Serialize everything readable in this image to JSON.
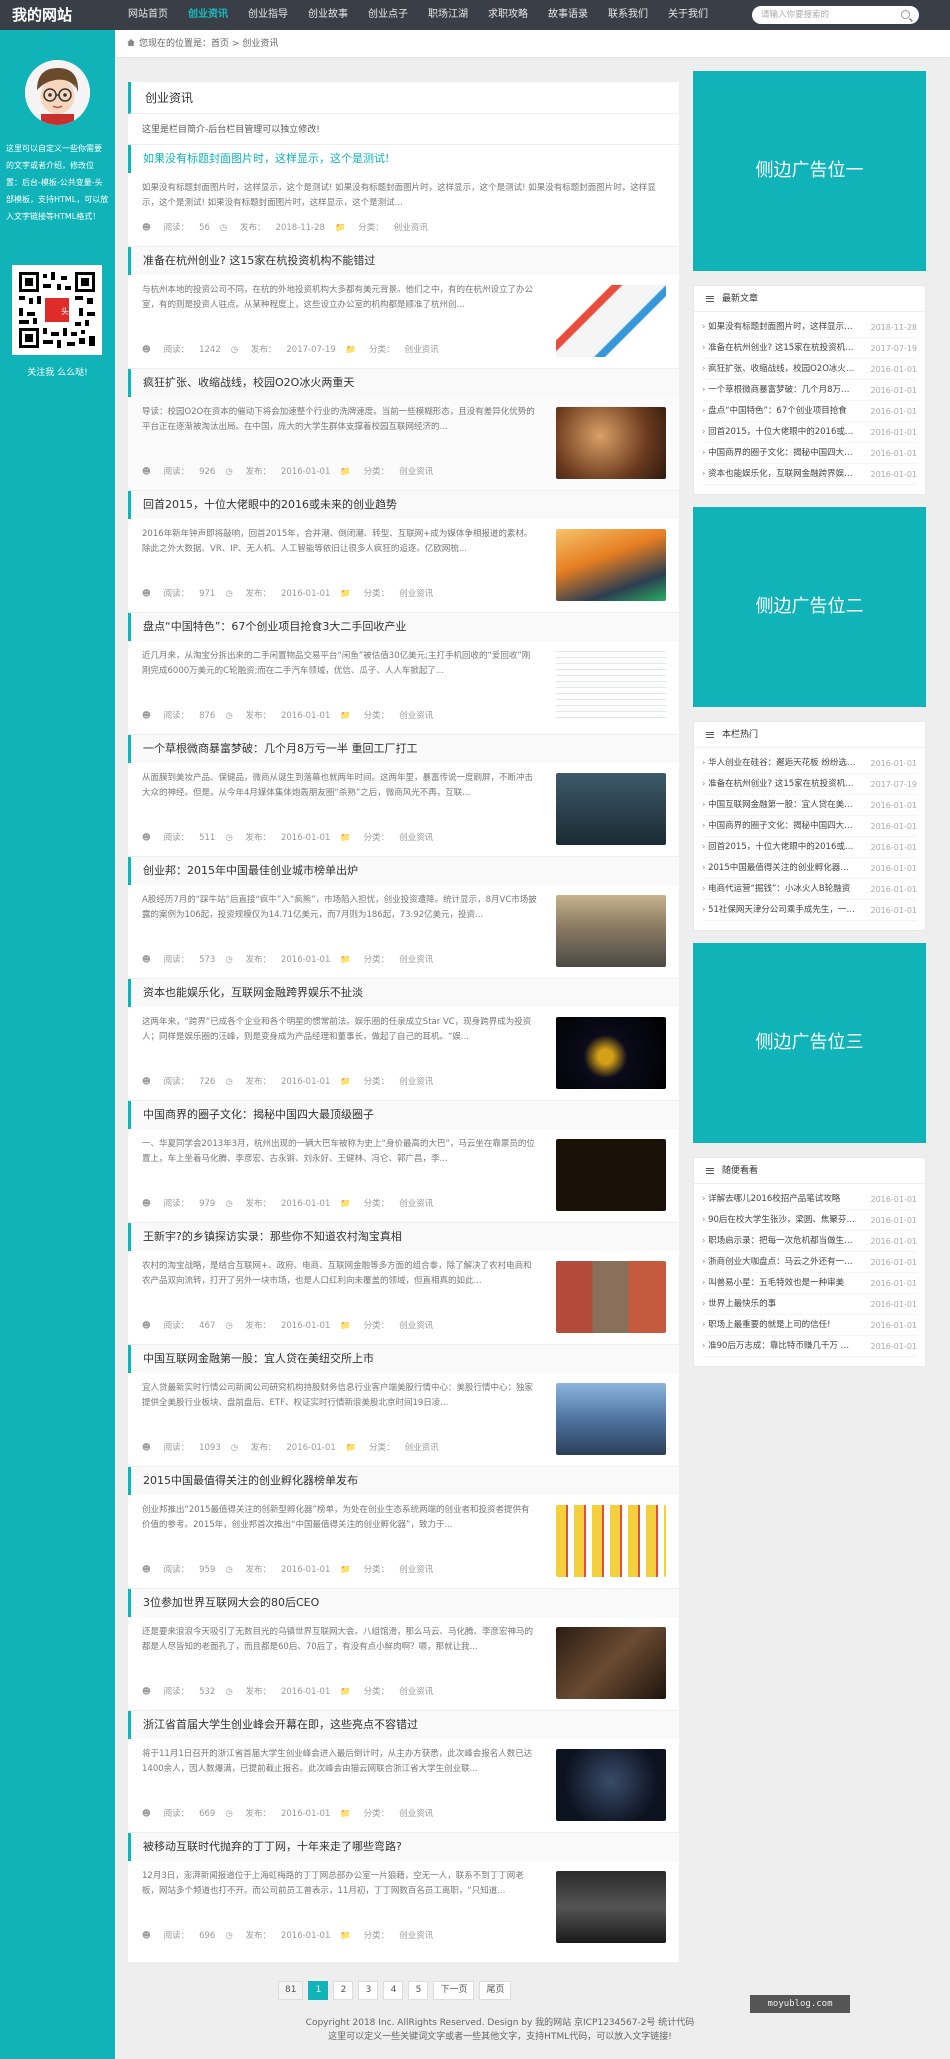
{
  "site": {
    "logo": "我的网站"
  },
  "nav": [
    "网站首页",
    "创业资讯",
    "创业指导",
    "创业故事",
    "创业点子",
    "职场江湖",
    "求职攻略",
    "故事语录",
    "联系我们",
    "关于我们"
  ],
  "search": {
    "placeholder": "请输入你要搜索的"
  },
  "left": {
    "profile_text": "这里可以自定义一些你需要的文字或者介绍，修改位置：后台-模板-公共变量-头部模板，支持HTML，可以放入文字链接等HTML格式！",
    "qr_badge": "头条",
    "follow": "关注我 么么哒!"
  },
  "breadcrumb": {
    "prefix": "您现在的位置是：",
    "home": "首页",
    "sep": ">",
    "current": "创业资讯"
  },
  "main": {
    "header": "创业资讯",
    "desc": "这里是栏目简介-后台栏目管理可以独立修改!",
    "meta_labels": {
      "reads": "阅读：",
      "posted": "发布：",
      "category": "分类："
    },
    "articles": [
      {
        "title": "如果没有标题封面图片时，这样显示，这个是测试!",
        "excerpt": "如果没有标题封面图片时，这样显示，这个是测试! 如果没有标题封面图片时，这样显示，这个是测试! 如果没有标题封面图片时，这样显示，这个是测试! 如果没有标题封面图片时，这样显示，这个是测试...",
        "reads": "56",
        "date": "2018-11-28",
        "cat": "创业资讯"
      },
      {
        "title": "准备在杭州创业? 这15家在杭投资机构不能错过",
        "excerpt": "与杭州本地的投资公司不同，在杭的外地投资机构大多都有美元背景。他们之中，有的在杭州设立了办公室，有的则是投资人驻点。从某种程度上，这些设立办公室的机构都是顺准了杭州创...",
        "reads": "1242",
        "date": "2017-07-19",
        "cat": "创业资讯"
      },
      {
        "title": "疯狂扩张、收缩战线，校园O2O冰火两重天",
        "excerpt": "导读：校园O2O在资本的催动下将会加速整个行业的洗牌速度。当前一些模糊形态，且没有差异化优势的平台正在逐渐被淘汰出局。在中国，庞大的大学生群体支撑着校园互联网经济的...",
        "reads": "926",
        "date": "2016-01-01",
        "cat": "创业资讯"
      },
      {
        "title": "回首2015，十位大佬眼中的2016或未来的创业趋势",
        "excerpt": "2016年新年钟声即将敲响，回首2015年，合并潮、倒闭潮、转型、互联网+成为媒体争相报道的素材。除此之外大数据、VR、IP、无人机、人工智能等依旧让很多人疯狂的追逐。亿欧网梳...",
        "reads": "971",
        "date": "2016-01-01",
        "cat": "创业资讯"
      },
      {
        "title": "盘点“中国特色”：67个创业项目抢食3大二手回收产业",
        "excerpt": "近几月来，从淘宝分拆出来的二手闲置物品交易平台“闲鱼”被估值30亿美元;主打手机回收的“爱回收”刚刚完成6000万美元的C轮融资;而在二手汽车领域，优信、瓜子、人人车掀起了...",
        "reads": "876",
        "date": "2016-01-01",
        "cat": "创业资讯"
      },
      {
        "title": "一个草根微商暴富梦破：几个月8万亏一半 重回工厂打工",
        "excerpt": "从面膜到美妆产品、保健品，微商从诞生到落幕也就两年时间。这两年里，暴富传说一度刷屏，不断冲击大众的神经。但是，从今年4月媒体集体炮轰朋友圈“杀熟”之后，微商风光不再，互联...",
        "reads": "511",
        "date": "2016-01-01",
        "cat": "创业资讯"
      },
      {
        "title": "创业邦：2015年中国最佳创业城市榜单出炉",
        "excerpt": "A股经历7月的“踩牛站”后直接“疯牛”入“疯熊”，市场陷入担忧，创业投资遭降。统计显示，8月VC市场披露的案例为106起，投资规模仅为14.71亿美元，而7月则为186起，73.92亿美元，投资...",
        "reads": "573",
        "date": "2016-01-01",
        "cat": "创业资讯"
      },
      {
        "title": "资本也能娱乐化，互联网金融跨界娱乐不扯淡",
        "excerpt": "这两年来，“跨界”已成各个企业和各个明星的惯常前法。娱乐圈的任泉成立Star VC，现身跨界成为投资人；同样是娱乐圈的汪峰，则是变身成为产品经理和董事长，做起了自己的耳机。“娱...",
        "reads": "726",
        "date": "2016-01-01",
        "cat": "创业资讯"
      },
      {
        "title": "中国商界的圈子文化：揭秘中国四大最顶级圈子",
        "excerpt": "一、华夏同学会2013年3月，杭州出现的一辆大巴车被称为史上“身价最高的大巴”，马云坐在靠票员的位置上，车上坐着马化腾、李彦宏、古永锵、刘永好、王健林、冯仑、郭广昌，李...",
        "reads": "979",
        "date": "2016-01-01",
        "cat": "创业资讯"
      },
      {
        "title": "王新宇?的乡镇探访实录：那些你不知道农村淘宝真相",
        "excerpt": "农村的淘宝战略，是结合互联网+、政府、电商、互联网金融等多方面的组合拳，除了解决了农村电商和农产品双向流转，打开了另外一块市场，也是人口红利向未覆盖的领域，但直相真的如此...",
        "reads": "467",
        "date": "2016-01-01",
        "cat": "创业资讯"
      },
      {
        "title": "中国互联网金融第一股：宜人贷在美纽交所上市",
        "excerpt": "宜人贷最新实时行情公司新闻公司研究机构持股财务信息行业客户端美股行情中心：美股行情中心：独家提供全美股行业板块、盘前盘后、ETF、权证实时行情新浪美股北京时间19日凌...",
        "reads": "1093",
        "date": "2016-01-01",
        "cat": "创业资讯"
      },
      {
        "title": "2015中国最值得关注的创业孵化器榜单发布",
        "excerpt": "创业邦推出“2015最值得关注的创新型孵化器”榜单，为处在创业生态系统两端的创业者和投资者提供有价值的参考。2015年，创业邦首次推出“中国最值得关注的创业孵化器”，致力于...",
        "reads": "959",
        "date": "2016-01-01",
        "cat": "创业资讯"
      },
      {
        "title": "3位参加世界互联网大会的80后CEO",
        "excerpt": "还是要来浪浪今天吸引了无数目光的乌镇世界互联网大会。八组馆滑，那么马云、马化腾、李彦宏神马的都是人尽皆知的老面孔了，而且都是60后、70后了，有没有点小鲜肉啊？嗯，那就让我...",
        "reads": "532",
        "date": "2016-01-01",
        "cat": "创业资讯"
      },
      {
        "title": "浙江省首届大学生创业峰会开幕在即，这些亮点不容错过",
        "excerpt": "将于11月1日召开的浙江省首届大学生创业峰会进入最后倒计时，从主办方获悉，此次峰会报名人数已达1400余人，因人数爆满，已提前截止报名。此次峰会由猫云网联合浙江省大学生创业联...",
        "reads": "669",
        "date": "2016-01-01",
        "cat": "创业资讯"
      },
      {
        "title": "被移动互联时代抛弃的丁丁网，十年来走了哪些弯路?",
        "excerpt": "12月3日，澎湃新闻报道位于上海虹梅路的丁丁网总部办公室一片狼藉，空无一人，联系不到丁丁网老板，网站多个频道也打不开。而公司前员工曾表示，11月初，丁丁网数百名员工离职，“只知道...",
        "reads": "696",
        "date": "2016-01-01",
        "cat": "创业资讯"
      }
    ]
  },
  "pagination": {
    "count": "81",
    "pages": [
      "1",
      "2",
      "3",
      "4",
      "5"
    ],
    "next": "下一页",
    "last": "尾页"
  },
  "sidebar": {
    "ads": [
      "侧边广告位一",
      "侧边广告位二",
      "侧边广告位三"
    ],
    "latest": {
      "title": "最新文章",
      "items": [
        {
          "t": "如果没有标题封面图片时，这样显示，这个是测试!",
          "d": "2018-11-28"
        },
        {
          "t": "准备在杭州创业? 这15家在杭投资机构不能错过",
          "d": "2017-07-19"
        },
        {
          "t": "疯狂扩张、收缩战线，校园O2O冰火两重天",
          "d": "2016-01-01"
        },
        {
          "t": "一个草根微商暴富梦破：几个月8万亏一半",
          "d": "2016-01-01"
        },
        {
          "t": "盘点“中国特色”：67个创业项目抢食",
          "d": "2016-01-01"
        },
        {
          "t": "回首2015，十位大佬眼中的2016或未来",
          "d": "2016-01-01"
        },
        {
          "t": "中国商界的圈子文化：揭秘中国四大最顶级圈子",
          "d": "2016-01-01"
        },
        {
          "t": "资本也能娱乐化，互联网金融跨界娱乐不扯淡",
          "d": "2016-01-01"
        }
      ]
    },
    "hot": {
      "title": "本栏热门",
      "items": [
        {
          "t": "华人创业在硅谷：邂逅天花板 纷纷选择创业",
          "d": "2016-01-01"
        },
        {
          "t": "准备在杭州创业? 这15家在杭投资机构不能错过",
          "d": "2017-07-19"
        },
        {
          "t": "中国互联网金融第一股：宜人贷在美纽交所上市",
          "d": "2016-01-01"
        },
        {
          "t": "中国商界的圈子文化：揭秘中国四大最顶级圈子",
          "d": "2016-01-01"
        },
        {
          "t": "回首2015，十位大佬眼中的2016或未来",
          "d": "2016-01-01"
        },
        {
          "t": "2015中国最值得关注的创业孵化器榜单发布",
          "d": "2016-01-01"
        },
        {
          "t": "电商代运营“掘钱”：小冰火人B轮融资",
          "d": "2016-01-01"
        },
        {
          "t": "51社保网天津分公司乘手成先生，一位创业者",
          "d": "2016-01-01"
        }
      ]
    },
    "random": {
      "title": "随便看看",
      "items": [
        {
          "t": "详解去哪儿2016校招产品笔试攻略",
          "d": "2016-01-01"
        },
        {
          "t": "90后在校大学生张沙，梁圆、焦聚芬：创业",
          "d": "2016-01-01"
        },
        {
          "t": "职场启示录：把每一次危机都当做生命中的",
          "d": "2016-01-01"
        },
        {
          "t": "浙商创业大咖盘点：马云之外还有一批大佬",
          "d": "2016-01-01"
        },
        {
          "t": "叫兽易小星：五毛特效也是一种审美",
          "d": "2016-01-01"
        },
        {
          "t": "世界上最快乐的事",
          "d": "2016-01-01"
        },
        {
          "t": "职场上最重要的就是上司的信任!",
          "d": "2016-01-01"
        },
        {
          "t": "准90后万志成：靠比特币赚几千万 现在...",
          "d": "2016-01-01"
        }
      ]
    }
  },
  "footer": {
    "line1": "Copyright 2018 Inc. AllRights Reserved. Design by 我的网站 京ICP1234567-2号 统计代码",
    "line2": "这里可以定义一些关键词文字或者一些其他文字，支持HTML代码，可以放入文字链接!"
  },
  "watermark": "moyublog.com",
  "colors": {
    "accent": "#0fb3b8",
    "topbar": "#3a3f47",
    "page_bg": "#eeeeee"
  }
}
